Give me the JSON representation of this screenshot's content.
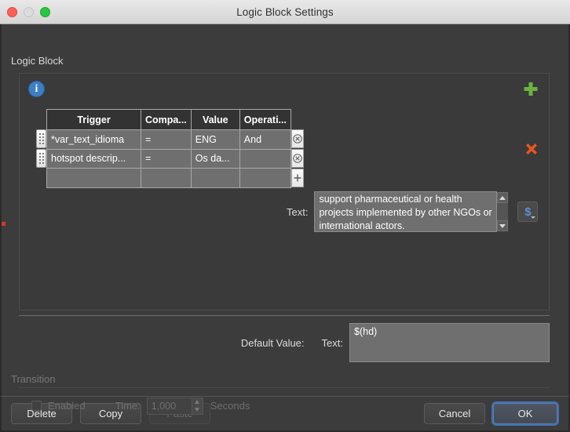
{
  "window": {
    "title": "Logic Block Settings",
    "traffic_lights": [
      "close-red",
      "minimize-gray",
      "zoom-green"
    ]
  },
  "section": {
    "title": "Logic Block",
    "info_icon": "info-icon",
    "add_icon": "green-plus-icon",
    "delete_icon": "red-x-icon"
  },
  "table": {
    "columns": [
      "Trigger",
      "Compa...",
      "Value",
      "Operati..."
    ],
    "rows": [
      {
        "trigger": "*var_text_idioma",
        "comparison": "=",
        "value": "ENG",
        "operation": "And",
        "action": "circle-x-icon"
      },
      {
        "trigger": "hotspot descrip...",
        "comparison": "=",
        "value": "Os da...",
        "operation": "",
        "action": "circle-x-icon"
      },
      {
        "trigger": "",
        "comparison": "",
        "value": "",
        "operation": "",
        "action": "plus-icon"
      }
    ]
  },
  "text_field": {
    "label": "Text:",
    "value": "support pharmaceutical or health projects implemented by other NGOs or international actors.",
    "scroll_up_icon": "triangle-up-icon",
    "scroll_down_icon": "triangle-down-icon",
    "variable_button": "$",
    "variable_button_caret": "chevron-down-icon"
  },
  "default_value": {
    "label": "Default Value:",
    "text_label": "Text:",
    "value": "$(hd)"
  },
  "transition": {
    "title": "Transition",
    "enabled_label": "Enabled",
    "enabled_checked": false,
    "time_label": "Time:",
    "time_value": "1,000",
    "seconds_label": "Seconds"
  },
  "footer": {
    "delete": "Delete",
    "copy": "Copy",
    "paste": "Paste",
    "cancel": "Cancel",
    "ok": "OK"
  },
  "colors": {
    "window_bg": "#3c3c3c",
    "panel_bg": "#3a3a3a",
    "field_bg": "#6f6f6f",
    "accent_blue": "#3f72b8",
    "info_blue": "#3d7fc4",
    "add_green": "#6cb33f",
    "delete_orange": "#e8561f",
    "dollar_blue": "#5b8fd4"
  }
}
